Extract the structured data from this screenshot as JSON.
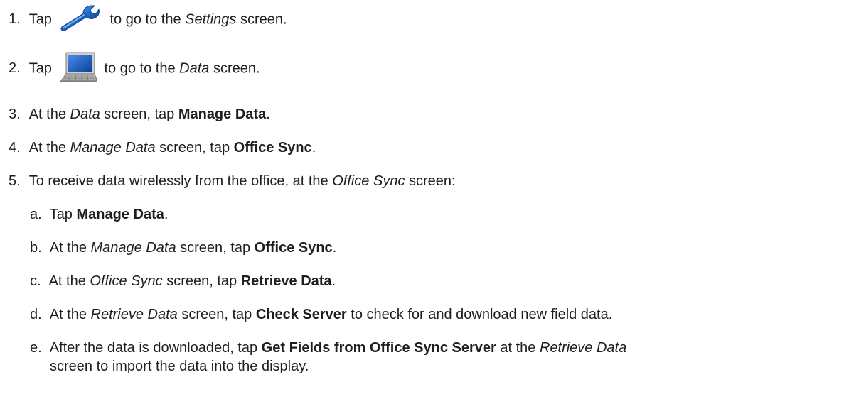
{
  "steps": [
    {
      "num": "1.",
      "pre": "Tap",
      "icon": "wrench-icon",
      "post1": " to go to the ",
      "em": "Settings",
      "post2": " screen."
    },
    {
      "num": "2.",
      "pre": "Tap",
      "icon": "laptop-icon",
      "post1": " to go to the ",
      "em": "Data",
      "post2": " screen."
    },
    {
      "num": "3.",
      "t1": "At the ",
      "em": "Data",
      "t2": " screen, tap ",
      "bold": "Manage Data",
      "t3": "."
    },
    {
      "num": "4.",
      "t1": "At the ",
      "em": "Manage Data",
      "t2": " screen, tap ",
      "bold": "Office Sync",
      "t3": "."
    },
    {
      "num": "5.",
      "t1": "To receive data wirelessly from the office, at the ",
      "em": "Office Sync",
      "t2": " screen:"
    }
  ],
  "substeps": [
    {
      "num": "a.",
      "t1": "Tap ",
      "bold": "Manage Data",
      "t2": "."
    },
    {
      "num": "b.",
      "t1": "At the ",
      "em": "Manage Data",
      "t2": " screen, tap ",
      "bold": "Office Sync",
      "t3": "."
    },
    {
      "num": "c.",
      "t1": "At the ",
      "em": "Office Sync",
      "t2": " screen, tap ",
      "bold": "Retrieve Data",
      "t3": "."
    },
    {
      "num": "d.",
      "t1": "At the ",
      "em": "Retrieve Data",
      "t2": " screen, tap ",
      "bold": "Check Server",
      "t3": " to check for and download new field data."
    },
    {
      "num": "e.",
      "t1": "After the data is downloaded, tap ",
      "bold": "Get Fields from Office Sync Server",
      "t2": " at the ",
      "em": "Retrieve Data",
      "line2": "screen to import the data into the display."
    }
  ]
}
